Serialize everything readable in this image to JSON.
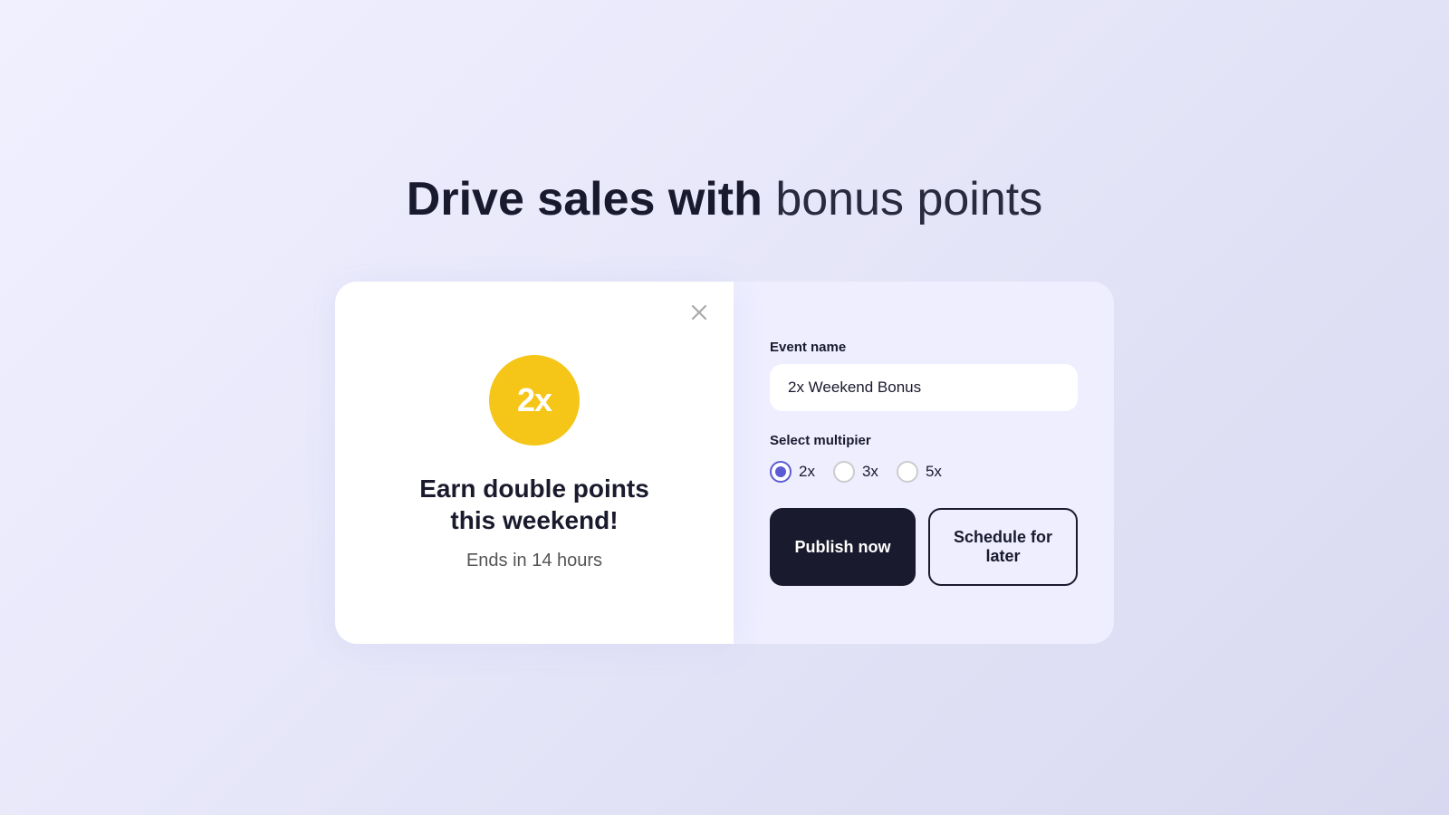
{
  "page": {
    "title_bold": "Drive sales with",
    "title_light": "bonus points"
  },
  "preview_card": {
    "multiplier": "2x",
    "headline": "Earn double points\nthis weekend!",
    "subtext": "Ends in 14 hours",
    "close_icon": "✕"
  },
  "form": {
    "event_name_label": "Event name",
    "event_name_value": "2x Weekend Bonus",
    "multiplier_label": "Select multipier",
    "multiplier_options": [
      {
        "value": "2x",
        "selected": true
      },
      {
        "value": "3x",
        "selected": false
      },
      {
        "value": "5x",
        "selected": false
      }
    ]
  },
  "buttons": {
    "publish_label": "Publish now",
    "schedule_label": "Schedule for later"
  }
}
